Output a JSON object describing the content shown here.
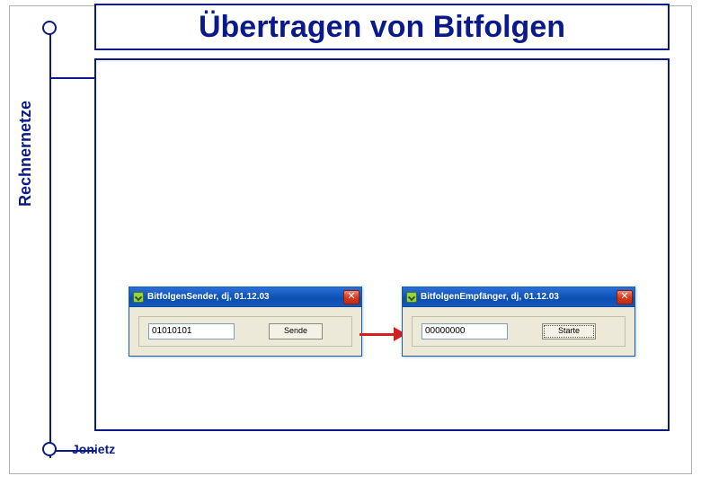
{
  "slide": {
    "title": "Übertragen von Bitfolgen",
    "sidebar_label": "Rechnernetze",
    "author": "Jonietz"
  },
  "colors": {
    "accent": "#0a1a8a",
    "xp_titlebar": "#1658bd",
    "xp_close": "#d63a1f",
    "arrow": "#d51e1e"
  },
  "sender_window": {
    "title": "BitfolgenSender, dj, 01.12.03",
    "input_value": "01010101",
    "button_label": "Sende",
    "close_glyph": "✕"
  },
  "receiver_window": {
    "title": "BitfolgenEmpfänger, dj, 01.12.03",
    "input_value": "00000000",
    "button_label": "Starte",
    "close_glyph": "✕"
  }
}
